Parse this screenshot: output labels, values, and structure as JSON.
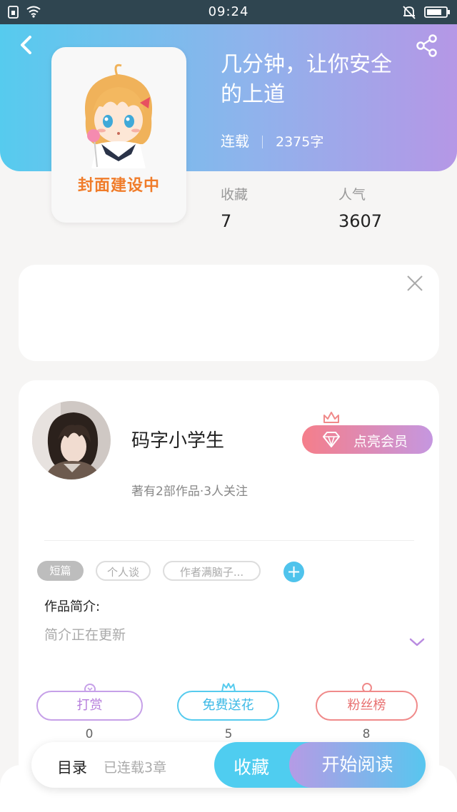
{
  "status_bar": {
    "time": "09:24"
  },
  "book": {
    "title": "几分钟，让你安全的上道",
    "cover_label": "封面建设中",
    "status": "连载",
    "word_count": "2375字",
    "stats": {
      "favorites_label": "收藏",
      "favorites_value": "7",
      "popularity_label": "人气",
      "popularity_value": "3607"
    }
  },
  "author": {
    "name": "码字小学生",
    "meta": "著有2部作品·3人关注",
    "vip_button": "点亮会员"
  },
  "tags": [
    "短篇",
    "个人谈",
    "作者满脑子..."
  ],
  "intro": {
    "label": "作品简介:",
    "text": "简介正在更新"
  },
  "actions": [
    {
      "label": "打赏",
      "count": "0"
    },
    {
      "label": "免费送花",
      "count": "5"
    },
    {
      "label": "粉丝榜",
      "count": "8"
    }
  ],
  "bottom_bar": {
    "toc_label": "目录",
    "chapter_count": "已连载3章",
    "collect_label": "收藏",
    "read_label": "开始阅读"
  },
  "colors": {
    "hero_gradient_start": "#56cbee",
    "hero_gradient_end": "#b597e6",
    "accent_blue": "#4fcdf0",
    "accent_purple": "#b59be5",
    "vip_pink": "#f57e8a"
  }
}
